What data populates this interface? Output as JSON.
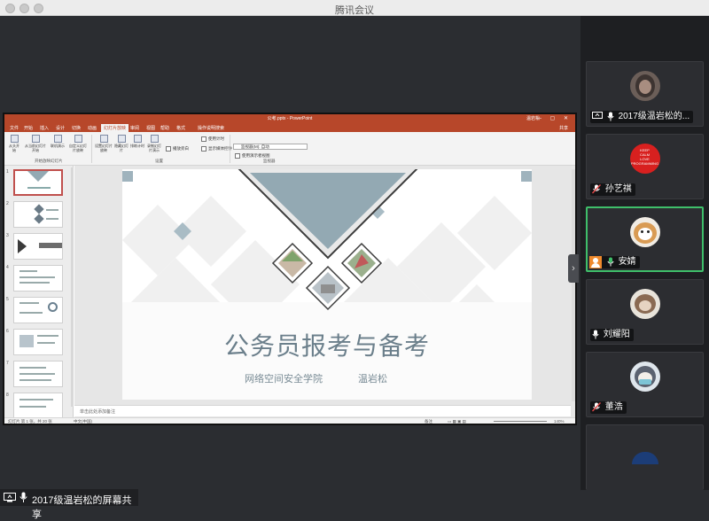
{
  "window": {
    "title": "腾讯会议"
  },
  "share_label": "2017级温岩松的屏幕共享",
  "ppt": {
    "title": "公考.pptx - PowerPoint",
    "user": "温岩松",
    "tabs": [
      "文件",
      "开始",
      "插入",
      "设计",
      "切换",
      "动画",
      "幻灯片放映",
      "审阅",
      "视图",
      "帮助",
      "格式",
      "操作说明搜索"
    ],
    "share": "共享",
    "ribbon_buttons": [
      "从头开始",
      "从当前幻灯片开始",
      "联机演示",
      "自定义幻灯片放映",
      "设置幻灯片放映",
      "隐藏幻灯片",
      "排练计时",
      "录制幻灯片演示"
    ],
    "checkboxes": [
      "播放旁白",
      "使用计时",
      "显示媒体控件",
      "使用演示者视图"
    ],
    "monitor_label": "监视器(M):",
    "monitor_value": "自动",
    "groups": [
      "开始放映幻灯片",
      "设置",
      "监视器"
    ],
    "slide": {
      "title": "公务员报考与备考",
      "school": "网络空间安全学院",
      "author": "温岩松"
    },
    "notes": "单击此处添加备注",
    "status_left": "幻灯片 第 1 张，共 20 张",
    "status_lang": "中文(中国)",
    "status_notes": "备注",
    "zoom": "140%",
    "thumb_numbers": [
      "1",
      "2",
      "3",
      "4",
      "5",
      "6",
      "7",
      "8"
    ]
  },
  "participants": [
    {
      "name": "2017级温岩松的...",
      "mic": "on",
      "sharing": true
    },
    {
      "name": "孙艺祺",
      "mic": "off",
      "badge_text": [
        "KEEP",
        "CALM",
        "LOVE",
        "PROGRAMMING"
      ]
    },
    {
      "name": "安婧",
      "mic": "on",
      "active": true,
      "host": true
    },
    {
      "name": "刘耀阳",
      "mic": "on"
    },
    {
      "name": "董浩",
      "mic": "off"
    }
  ]
}
